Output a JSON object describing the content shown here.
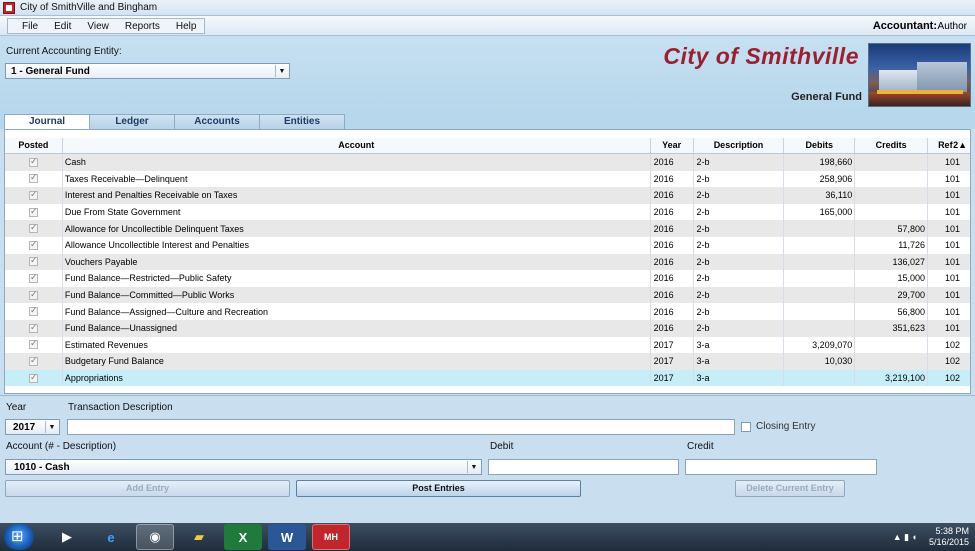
{
  "window": {
    "title": "City of SmithVille and Bingham"
  },
  "menu": {
    "items": [
      "File",
      "Edit",
      "View",
      "Reports",
      "Help"
    ]
  },
  "accountant": {
    "label": "Accountant:",
    "value": "Author"
  },
  "header": {
    "entity_label": "Current Accounting Entity:",
    "entity_value": "1 - General Fund",
    "city_name": "City of Smithville",
    "fund_name": "General Fund"
  },
  "tabs": [
    "Journal",
    "Ledger",
    "Accounts",
    "Entities"
  ],
  "grid": {
    "columns": [
      "Posted",
      "Account",
      "Year",
      "Description",
      "Debits",
      "Credits",
      "Ref",
      "2"
    ],
    "rows": [
      {
        "account": "Cash",
        "year": "2016",
        "desc": "2-b",
        "debit": "198,660",
        "credit": "",
        "ref": "101"
      },
      {
        "account": "Taxes Receivable—Delinquent",
        "year": "2016",
        "desc": "2-b",
        "debit": "258,906",
        "credit": "",
        "ref": "101"
      },
      {
        "account": "Interest and Penalties Receivable on Taxes",
        "year": "2016",
        "desc": "2-b",
        "debit": "36,110",
        "credit": "",
        "ref": "101"
      },
      {
        "account": "Due From State Government",
        "year": "2016",
        "desc": "2-b",
        "debit": "165,000",
        "credit": "",
        "ref": "101"
      },
      {
        "account": "Allowance for Uncollectible Delinquent Taxes",
        "year": "2016",
        "desc": "2-b",
        "debit": "",
        "credit": "57,800",
        "ref": "101"
      },
      {
        "account": "Allowance Uncollectible Interest and Penalties",
        "year": "2016",
        "desc": "2-b",
        "debit": "",
        "credit": "11,726",
        "ref": "101"
      },
      {
        "account": "Vouchers Payable",
        "year": "2016",
        "desc": "2-b",
        "debit": "",
        "credit": "136,027",
        "ref": "101"
      },
      {
        "account": "Fund Balance—Restricted—Public Safety",
        "year": "2016",
        "desc": "2-b",
        "debit": "",
        "credit": "15,000",
        "ref": "101"
      },
      {
        "account": "Fund Balance—Committed—Public Works",
        "year": "2016",
        "desc": "2-b",
        "debit": "",
        "credit": "29,700",
        "ref": "101"
      },
      {
        "account": "Fund Balance—Assigned—Culture and Recreation",
        "year": "2016",
        "desc": "2-b",
        "debit": "",
        "credit": "56,800",
        "ref": "101"
      },
      {
        "account": "Fund Balance—Unassigned",
        "year": "2016",
        "desc": "2-b",
        "debit": "",
        "credit": "351,623",
        "ref": "101"
      },
      {
        "account": "Estimated Revenues",
        "year": "2017",
        "desc": "3-a",
        "debit": "3,209,070",
        "credit": "",
        "ref": "102"
      },
      {
        "account": "Budgetary Fund Balance",
        "year": "2017",
        "desc": "3-a",
        "debit": "10,030",
        "credit": "",
        "ref": "102"
      },
      {
        "account": "Appropriations",
        "year": "2017",
        "desc": "3-a",
        "debit": "",
        "credit": "3,219,100",
        "ref": "102"
      }
    ]
  },
  "form": {
    "year_label": "Year",
    "year_value": "2017",
    "txn_desc_label": "Transaction Description",
    "txn_desc_value": "",
    "closing_entry_label": "Closing Entry",
    "account_label": "Account (# - Description)",
    "account_value": "1010 - Cash",
    "debit_label": "Debit",
    "credit_label": "Credit",
    "add_entry": "Add Entry",
    "post_entries": "Post Entries",
    "delete_entry": "Delete Current Entry"
  },
  "taskbar": {
    "time": "5:38 PM",
    "date": "5/16/2015",
    "apps": [
      "media-player-icon",
      "internet-explorer-icon",
      "chrome-icon",
      "file-explorer-icon",
      "excel-icon",
      "word-icon",
      "mcgraw-hill-icon"
    ]
  }
}
